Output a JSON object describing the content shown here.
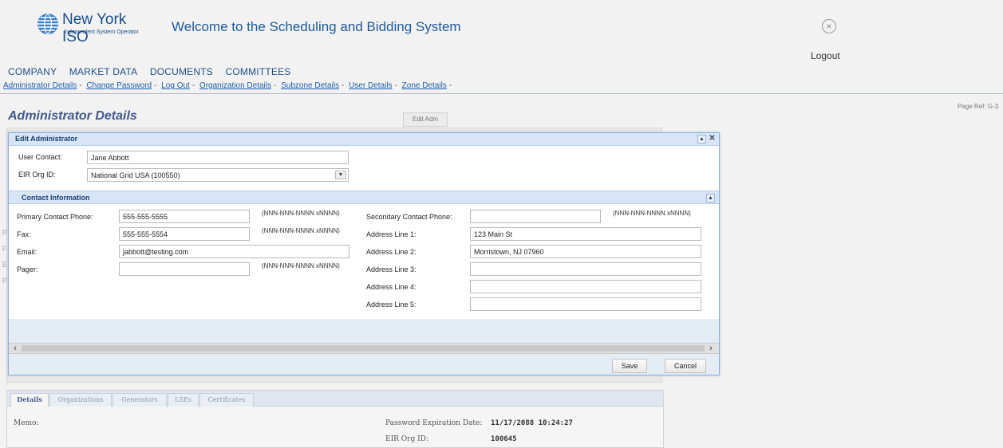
{
  "header": {
    "logo_name": "New York ISO",
    "logo_sub": "Independent System Operator",
    "welcome": "Welcome to the Scheduling and Bidding System",
    "logout": "Logout",
    "close_icon": "×"
  },
  "nav": [
    "COMPANY",
    "MARKET DATA",
    "DOCUMENTS",
    "COMMITTEES"
  ],
  "sub_nav": [
    "Administrator Details",
    "Change Password",
    "Log Out",
    "Organization Details",
    "Subzone Details",
    "User Details",
    "Zone Details"
  ],
  "page_ref": "Page Ref: G-3",
  "page_title": "Administrator Details",
  "edit_adm_button": "Edit Adm",
  "background_labels": [
    "P",
    "F",
    "E",
    "P"
  ],
  "dialog": {
    "title": "Edit Administrator",
    "user_contact_label": "User Contact:",
    "user_contact_value": "Jane Abbott",
    "eir_org_label": "EIR Org ID:",
    "eir_org_value": "National Grid USA (100550)",
    "contact_section_title": "Contact Information",
    "primary_phone_label": "Primary Contact Phone:",
    "primary_phone_value": "555-555-5555",
    "fax_label": "Fax:",
    "fax_value": "555-555-5554",
    "email_label": "Email:",
    "email_value": "jabbott@testing.com",
    "pager_label": "Pager:",
    "pager_value": "",
    "phone_hint": "(NNN-NNN-NNNN xNNNN)",
    "secondary_phone_label": "Secondary Contact Phone:",
    "secondary_phone_value": "",
    "address1_label": "Address Line 1:",
    "address1_value": "123 Main St",
    "address2_label": "Address Line 2:",
    "address2_value": "Morristown, NJ 07960",
    "address3_label": "Address Line 3:",
    "address3_value": "",
    "address4_label": "Address Line 4:",
    "address4_value": "",
    "address5_label": "Address Line 5:",
    "address5_value": "",
    "save_button": "Save",
    "cancel_button": "Cancel"
  },
  "tabs": [
    "Details",
    "Organizations",
    "Generators",
    "LSEs",
    "Certificates"
  ],
  "details": {
    "memo_label": "Memo:",
    "password_exp_label": "Password Expiration Date:",
    "password_exp_value": "11/17/2088 10:24:27",
    "eir_org_label": "EIR Org ID:",
    "eir_org_value": "100645"
  },
  "colors": {
    "brand_blue": "#1b4f8c",
    "dialog_header": "#d7e5f7",
    "title_blue": "#405a8c"
  },
  "icons": {
    "close": "close-icon",
    "collapse": "collapse-up-icon",
    "select_arrow": "chevron-down-icon",
    "scroll_left": "chevron-left-icon",
    "scroll_right": "chevron-right-icon"
  }
}
